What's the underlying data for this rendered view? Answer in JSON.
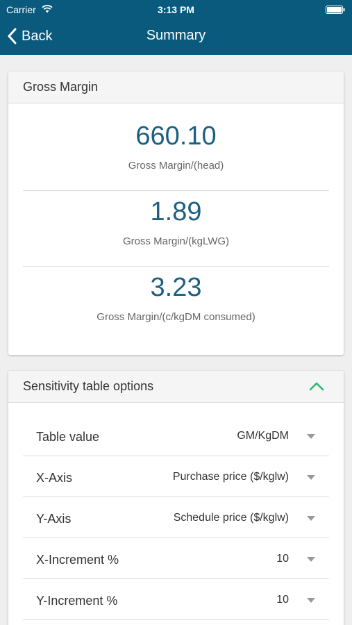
{
  "status_bar": {
    "carrier": "Carrier",
    "time": "3:13 PM"
  },
  "nav": {
    "back_label": "Back",
    "title": "Summary"
  },
  "gross_margin": {
    "header": "Gross Margin",
    "metrics": [
      {
        "value": "660.10",
        "label": "Gross Margin/(head)"
      },
      {
        "value": "1.89",
        "label": "Gross Margin/(kgLWG)"
      },
      {
        "value": "3.23",
        "label": "Gross Margin/(c/kgDM consumed)"
      }
    ]
  },
  "sensitivity": {
    "header": "Sensitivity table options",
    "options": [
      {
        "label": "Table value",
        "value": "GM/KgDM"
      },
      {
        "label": "X-Axis",
        "value": "Purchase price ($/kglw)"
      },
      {
        "label": "Y-Axis",
        "value": "Schedule price ($/kglw)"
      },
      {
        "label": "X-Increment %",
        "value": "10"
      },
      {
        "label": "Y-Increment %",
        "value": "10"
      }
    ]
  },
  "colors": {
    "nav_bar": "#0a5a7e",
    "metric_value": "#1d5f80",
    "collapse_chevron": "#2bb673"
  },
  "icons": {
    "wifi": "wifi-icon",
    "battery": "battery-icon",
    "back": "chevron-left-icon",
    "collapse": "chevron-up-icon",
    "dropdown": "caret-down-icon"
  }
}
